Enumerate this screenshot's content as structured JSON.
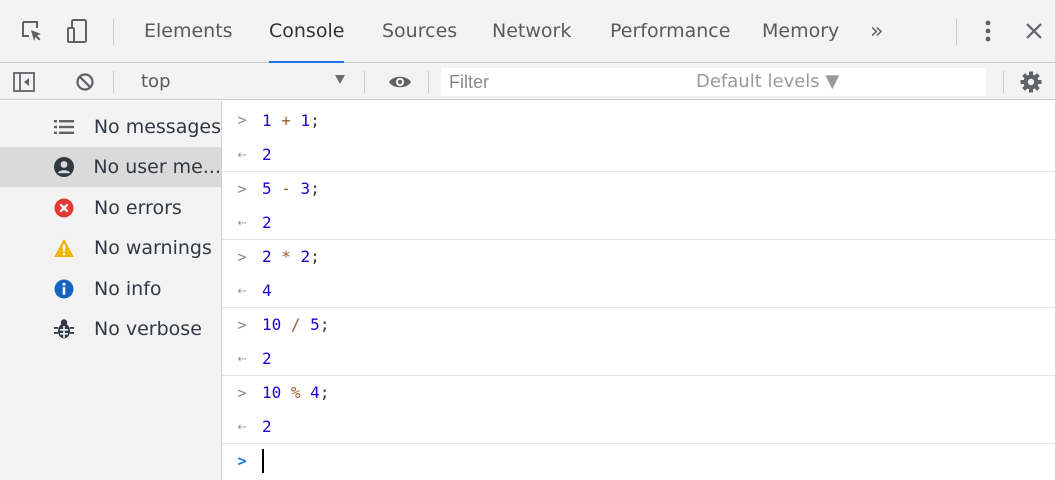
{
  "tabs": [
    {
      "label": "Elements"
    },
    {
      "label": "Console",
      "active": true
    },
    {
      "label": "Sources"
    },
    {
      "label": "Network"
    },
    {
      "label": "Performance"
    },
    {
      "label": "Memory"
    }
  ],
  "more_tabs_label": "»",
  "toolbar": {
    "context": "top",
    "filter_placeholder": "Filter",
    "levels": "Default levels ▼"
  },
  "sidebar": {
    "items": [
      {
        "label": "No messages",
        "icon": "list-icon"
      },
      {
        "label": "No user me...",
        "icon": "user-icon",
        "selected": true
      },
      {
        "label": "No errors",
        "icon": "error-icon"
      },
      {
        "label": "No warnings",
        "icon": "warning-icon"
      },
      {
        "label": "No info",
        "icon": "info-icon"
      },
      {
        "label": "No verbose",
        "icon": "bug-icon"
      }
    ]
  },
  "console": {
    "entries": [
      {
        "tokens": [
          {
            "t": "1",
            "k": "num"
          },
          {
            "t": " + ",
            "k": "op"
          },
          {
            "t": "1",
            "k": "num"
          },
          {
            "t": ";",
            "k": "plain"
          }
        ],
        "result": "2"
      },
      {
        "tokens": [
          {
            "t": "5",
            "k": "num"
          },
          {
            "t": " - ",
            "k": "op"
          },
          {
            "t": "3",
            "k": "num"
          },
          {
            "t": ";",
            "k": "plain"
          }
        ],
        "result": "2"
      },
      {
        "tokens": [
          {
            "t": "2",
            "k": "num"
          },
          {
            "t": " * ",
            "k": "op"
          },
          {
            "t": "2",
            "k": "num"
          },
          {
            "t": ";",
            "k": "plain"
          }
        ],
        "result": "4"
      },
      {
        "tokens": [
          {
            "t": "10",
            "k": "num"
          },
          {
            "t": " / ",
            "k": "op"
          },
          {
            "t": "5",
            "k": "num"
          },
          {
            "t": ";",
            "k": "plain"
          }
        ],
        "result": "2"
      },
      {
        "tokens": [
          {
            "t": "10",
            "k": "num"
          },
          {
            "t": " % ",
            "k": "op"
          },
          {
            "t": "4",
            "k": "num"
          },
          {
            "t": ";",
            "k": "plain"
          }
        ],
        "result": "2"
      }
    ]
  },
  "colors": {
    "accent": "#1a73e8",
    "error": "#e53935",
    "warning": "#f4b400",
    "info": "#1565c0",
    "number": "#1c00cf",
    "operator": "#a15b2b"
  }
}
